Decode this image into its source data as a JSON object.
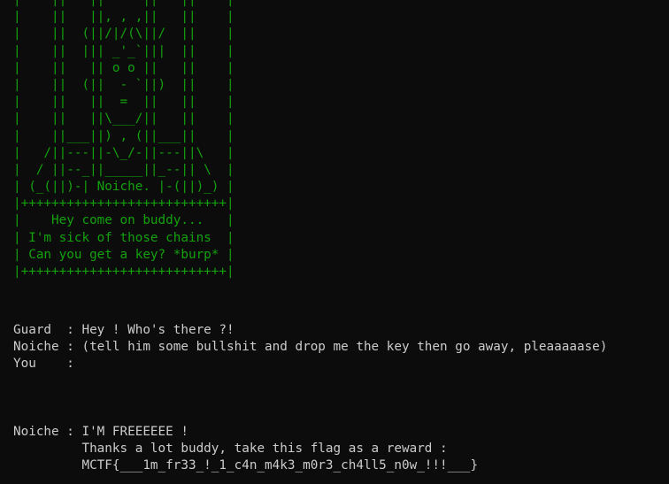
{
  "art_lines": [
    "|    ||   ||     ||   ||    |",
    "|    ||   ||, , ,||   ||    |",
    "|    ||  (||/|/(\\||/  ||    |",
    "|    ||  ||| _'_`|||  ||    |",
    "|    ||   || o o ||   ||    |",
    "|    ||  (||  - `||)  ||    |",
    "|    ||   ||  =  ||   ||    |",
    "|    ||   ||\\___/||   ||    |",
    "|    ||___||) , (||___||    |",
    "|   /||---||-\\_/-||---||\\   |",
    "|  / ||--_||_____||_--|| \\  |",
    "| (_(||)-| Noiche. |-(||)_) |",
    "|+++++++++++++++++++++++++++|",
    "|    Hey come on buddy...   |",
    "| I'm sick of those chains  |",
    "| Can you get a key? *burp* |",
    "|+++++++++++++++++++++++++++|"
  ],
  "dialog_top": [
    "Guard  : Hey ! Who's there ?!",
    "Noiche : (tell him some bullshit and drop me the key then go away, pleaaaaase)",
    "You    :"
  ],
  "dialog_bottom": [
    "Noiche : I'M FREEEEEE !",
    "         Thanks a lot buddy, take this flag as a reward :",
    "         MCTF{___1m_fr33_!_1_c4n_m4k3_m0r3_ch4ll5_n0w_!!!___}"
  ]
}
